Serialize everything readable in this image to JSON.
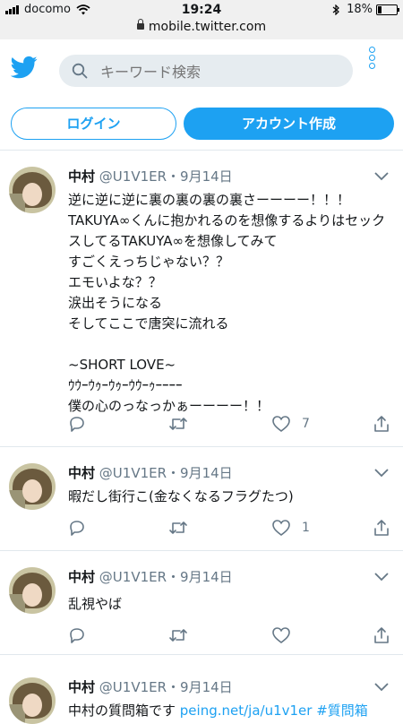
{
  "status_bar": {
    "carrier": "docomo",
    "time": "19:24",
    "battery_percent": "18%",
    "battery_level": 0.18
  },
  "browser": {
    "url": "mobile.twitter.com"
  },
  "header": {
    "search_placeholder": "キーワード検索",
    "login_label": "ログイン",
    "signup_label": "アカウント作成"
  },
  "colors": {
    "brand": "#1da1f2",
    "text": "#14171a",
    "secondary": "#657786",
    "search_bg": "#e6ecf0"
  },
  "tweets": [
    {
      "name": "中村",
      "handle": "@U1V1ER",
      "separator": "・",
      "date": "9月14日",
      "text": "逆に逆に逆に裏の裏の裏の裏さーーーー！！！\nTAKUYA∞くんに抱かれるのを想像するよりはセックスしてるTAKUYA∞を想像してみて\nすごくえっちじゃない？？\nエモいよな？？\n涙出そうになる\nそしてここで唐突に流れる\n\n~SHORT LOVE~\nｳｳｰｳｩｰｳｩｰｳｳｰｩｰｰｰｰ\n僕の心のっなっかぁーーーー！！",
      "like_count": "7"
    },
    {
      "name": "中村",
      "handle": "@U1V1ER",
      "separator": "・",
      "date": "9月14日",
      "text": "暇だし街行こ(金なくなるフラグたつ)",
      "like_count": "1"
    },
    {
      "name": "中村",
      "handle": "@U1V1ER",
      "separator": "・",
      "date": "9月14日",
      "text": "乱視やば",
      "like_count": ""
    },
    {
      "name": "中村",
      "handle": "@U1V1ER",
      "separator": "・",
      "date": "9月14日",
      "text_prefix": "中村の質問箱です ",
      "link": "peing.net/ja/u1v1er",
      "hashtag": " #質問箱"
    }
  ]
}
